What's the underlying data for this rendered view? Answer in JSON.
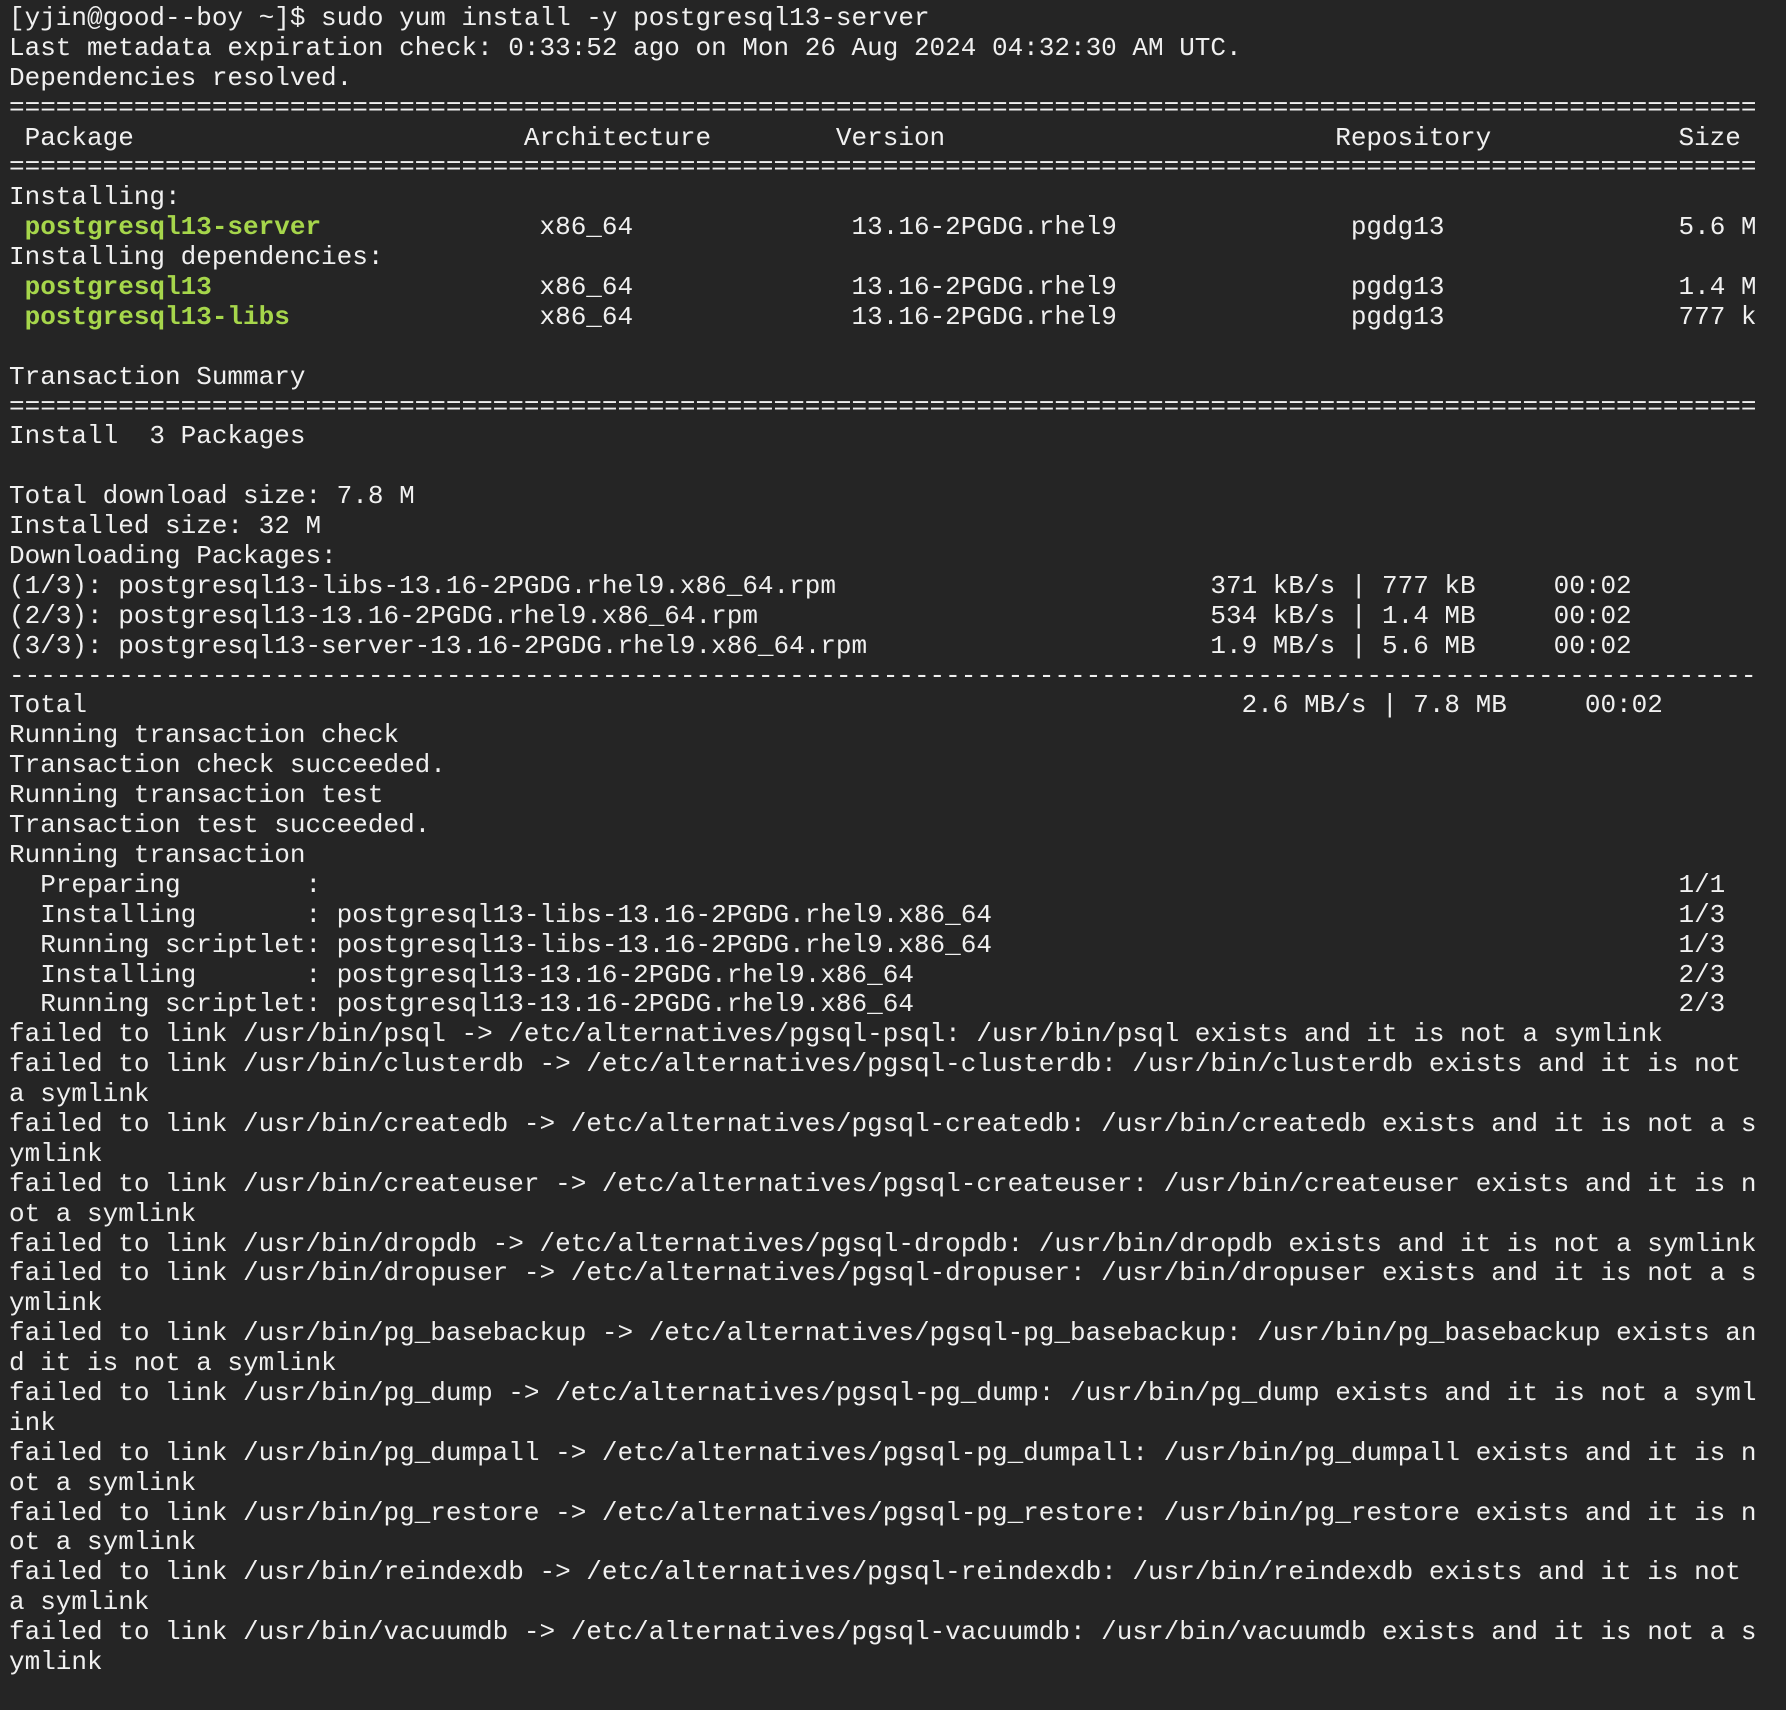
{
  "terminal": {
    "colors": {
      "background": "#252525",
      "foreground": "#f0f0f0",
      "package_highlight": "#a6d64b"
    },
    "lines": [
      {
        "text": "[yjin@good--boy ~]$ sudo yum install -y postgresql13-server"
      },
      {
        "text": "Last metadata expiration check: 0:33:52 ago on Mon 26 Aug 2024 04:32:30 AM UTC."
      },
      {
        "text": "Dependencies resolved."
      },
      {
        "text": "================================================================================================================"
      },
      {
        "text": " Package                         Architecture        Version                         Repository            Size"
      },
      {
        "text": "================================================================================================================"
      },
      {
        "text": "Installing:"
      },
      {
        "pkg": " postgresql13-server",
        "text": "              x86_64              13.16-2PGDG.rhel9               pgdg13               5.6 M"
      },
      {
        "text": "Installing dependencies:"
      },
      {
        "pkg": " postgresql13",
        "text": "                     x86_64              13.16-2PGDG.rhel9               pgdg13               1.4 M"
      },
      {
        "pkg": " postgresql13-libs",
        "text": "                x86_64              13.16-2PGDG.rhel9               pgdg13               777 k"
      },
      {
        "text": ""
      },
      {
        "text": "Transaction Summary"
      },
      {
        "text": "================================================================================================================"
      },
      {
        "text": "Install  3 Packages"
      },
      {
        "text": ""
      },
      {
        "text": "Total download size: 7.8 M"
      },
      {
        "text": "Installed size: 32 M"
      },
      {
        "text": "Downloading Packages:"
      },
      {
        "text": "(1/3): postgresql13-libs-13.16-2PGDG.rhel9.x86_64.rpm                        371 kB/s | 777 kB     00:02"
      },
      {
        "text": "(2/3): postgresql13-13.16-2PGDG.rhel9.x86_64.rpm                             534 kB/s | 1.4 MB     00:02"
      },
      {
        "text": "(3/3): postgresql13-server-13.16-2PGDG.rhel9.x86_64.rpm                      1.9 MB/s | 5.6 MB     00:02"
      },
      {
        "text": "----------------------------------------------------------------------------------------------------------------"
      },
      {
        "text": "Total                                                                          2.6 MB/s | 7.8 MB     00:02"
      },
      {
        "text": "Running transaction check"
      },
      {
        "text": "Transaction check succeeded."
      },
      {
        "text": "Running transaction test"
      },
      {
        "text": "Transaction test succeeded."
      },
      {
        "text": "Running transaction"
      },
      {
        "text": "  Preparing        :                                                                                       1/1"
      },
      {
        "text": "  Installing       : postgresql13-libs-13.16-2PGDG.rhel9.x86_64                                            1/3"
      },
      {
        "text": "  Running scriptlet: postgresql13-libs-13.16-2PGDG.rhel9.x86_64                                            1/3"
      },
      {
        "text": "  Installing       : postgresql13-13.16-2PGDG.rhel9.x86_64                                                 2/3"
      },
      {
        "text": "  Running scriptlet: postgresql13-13.16-2PGDG.rhel9.x86_64                                                 2/3"
      },
      {
        "text": "failed to link /usr/bin/psql -> /etc/alternatives/pgsql-psql: /usr/bin/psql exists and it is not a symlink"
      },
      {
        "text": "failed to link /usr/bin/clusterdb -> /etc/alternatives/pgsql-clusterdb: /usr/bin/clusterdb exists and it is not"
      },
      {
        "text": "a symlink"
      },
      {
        "text": "failed to link /usr/bin/createdb -> /etc/alternatives/pgsql-createdb: /usr/bin/createdb exists and it is not a s"
      },
      {
        "text": "ymlink"
      },
      {
        "text": "failed to link /usr/bin/createuser -> /etc/alternatives/pgsql-createuser: /usr/bin/createuser exists and it is n"
      },
      {
        "text": "ot a symlink"
      },
      {
        "text": "failed to link /usr/bin/dropdb -> /etc/alternatives/pgsql-dropdb: /usr/bin/dropdb exists and it is not a symlink"
      },
      {
        "text": "failed to link /usr/bin/dropuser -> /etc/alternatives/pgsql-dropuser: /usr/bin/dropuser exists and it is not a s"
      },
      {
        "text": "ymlink"
      },
      {
        "text": "failed to link /usr/bin/pg_basebackup -> /etc/alternatives/pgsql-pg_basebackup: /usr/bin/pg_basebackup exists an"
      },
      {
        "text": "d it is not a symlink"
      },
      {
        "text": "failed to link /usr/bin/pg_dump -> /etc/alternatives/pgsql-pg_dump: /usr/bin/pg_dump exists and it is not a syml"
      },
      {
        "text": "ink"
      },
      {
        "text": "failed to link /usr/bin/pg_dumpall -> /etc/alternatives/pgsql-pg_dumpall: /usr/bin/pg_dumpall exists and it is n"
      },
      {
        "text": "ot a symlink"
      },
      {
        "text": "failed to link /usr/bin/pg_restore -> /etc/alternatives/pgsql-pg_restore: /usr/bin/pg_restore exists and it is n"
      },
      {
        "text": "ot a symlink"
      },
      {
        "text": "failed to link /usr/bin/reindexdb -> /etc/alternatives/pgsql-reindexdb: /usr/bin/reindexdb exists and it is not"
      },
      {
        "text": "a symlink"
      },
      {
        "text": "failed to link /usr/bin/vacuumdb -> /etc/alternatives/pgsql-vacuumdb: /usr/bin/vacuumdb exists and it is not a s"
      },
      {
        "text": "ymlink"
      }
    ]
  }
}
